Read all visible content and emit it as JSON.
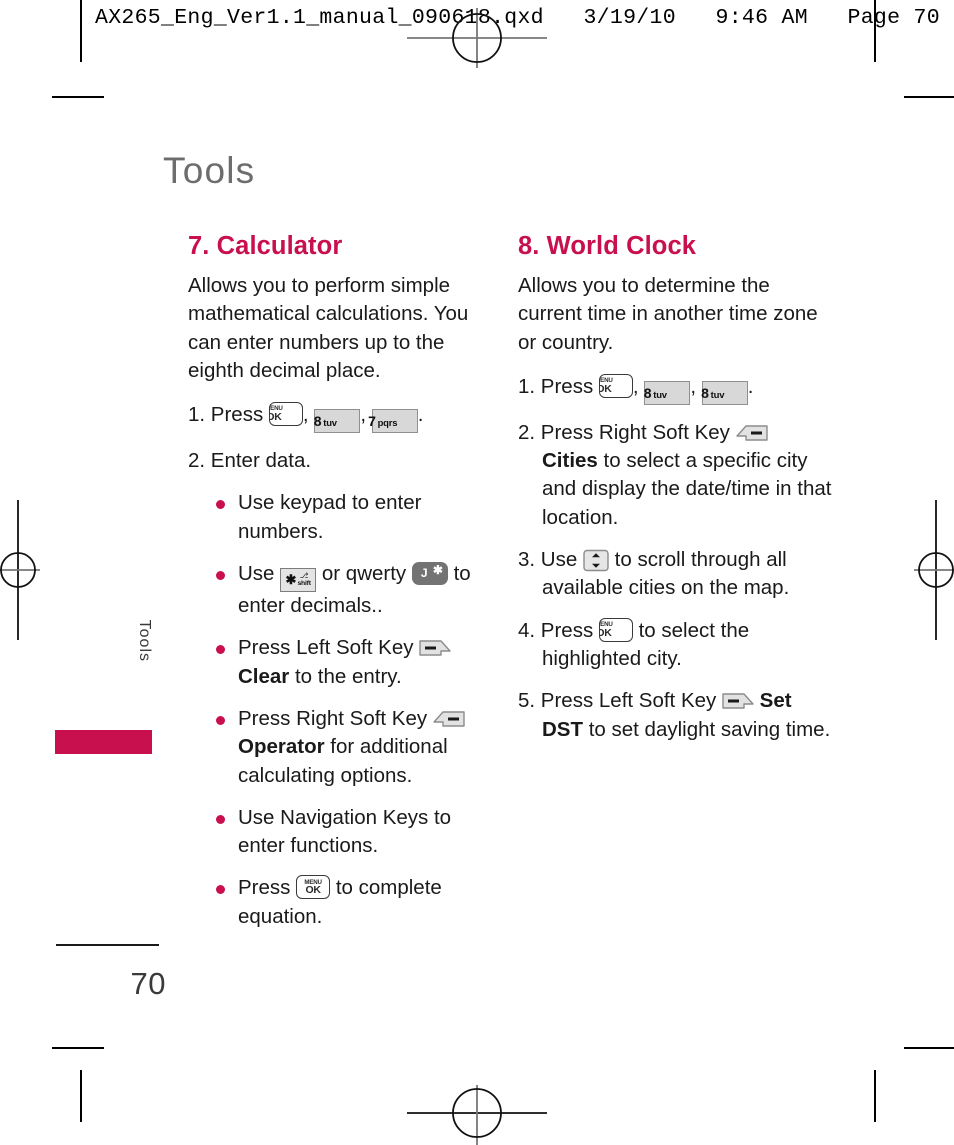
{
  "proof": {
    "header_text": "AX265_Eng_Ver1.1_manual_090618.qxd   3/19/10   9:46 AM   Page 70"
  },
  "page": {
    "chapter_title": "Tools",
    "side_tab_label": "Tools",
    "page_number": "70"
  },
  "left_column": {
    "heading": "7. Calculator",
    "intro": "Allows you to perform simple mathematical calculations. You can enter numbers up to the eighth decimal place.",
    "step1": {
      "prefix": "1. Press",
      "sep1": ",",
      "sep2": ",",
      "end": "."
    },
    "step2": "2. Enter data.",
    "bullets": {
      "b1": "Use keypad to enter numbers.",
      "b2_pre": "Use",
      "b2_mid": "or qwerty",
      "b2_post": "to enter decimals..",
      "b3_pre": "Press Left Soft Key",
      "b3_bold": "Clear",
      "b3_post": "to the entry.",
      "b4_pre": "Press Right Soft Key",
      "b4_bold": "Operator",
      "b4_post": "for additional calculating options.",
      "b5": "Use Navigation Keys to enter functions.",
      "b6_pre": "Press",
      "b6_post": "to complete equation."
    }
  },
  "right_column": {
    "heading": "8. World Clock",
    "intro": "Allows you to determine the current time in another time zone or country.",
    "step1": {
      "prefix": "1. Press",
      "sep1": ",",
      "sep2": ",",
      "end": "."
    },
    "step2": {
      "pre": "2. Press Right Soft Key",
      "bold": "Cities",
      "post": "to select a specific city and display the date/time in that location."
    },
    "step3": {
      "pre": "3. Use",
      "post": "to scroll through all available cities on the map."
    },
    "step4": {
      "pre": "4. Press",
      "post": "to select the highlighted city."
    },
    "step5": {
      "pre": "5. Press Left Soft Key",
      "bold": "Set DST",
      "post": "to set daylight saving time."
    }
  },
  "keys": {
    "menu_top": "MENU",
    "menu_bottom": "OK",
    "key8_digit": "8",
    "key8_letters": "tuv",
    "key7_digit": "7",
    "key7_letters": "pqrs",
    "shift_star": "✱",
    "shift_lock": "⎇",
    "shift_word": "shift",
    "qwerty_letter": "J",
    "qwerty_star": "✱"
  },
  "colors": {
    "accent": "#C8104E",
    "chapter_gray": "#6d6d6d",
    "body_text": "#1a1a1a"
  }
}
